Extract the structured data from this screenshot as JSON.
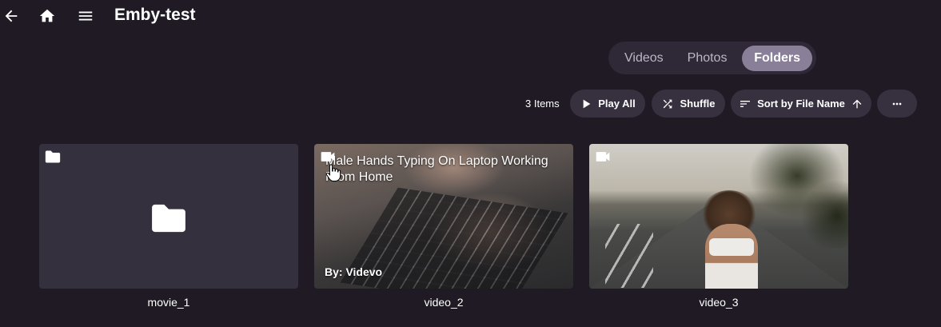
{
  "header": {
    "back_icon": "arrow-left-icon",
    "home_icon": "home-icon",
    "menu_icon": "hamburger-menu-icon",
    "title": "Emby-test"
  },
  "tabs": [
    {
      "label": "Videos",
      "active": false
    },
    {
      "label": "Photos",
      "active": false
    },
    {
      "label": "Folders",
      "active": true
    }
  ],
  "toolbar": {
    "items_count": "3 Items",
    "play_all": "Play All",
    "shuffle": "Shuffle",
    "sort": "Sort by File Name",
    "sort_direction": "ascending",
    "more_icon": "more-horizontal-icon"
  },
  "items": [
    {
      "name": "movie_1",
      "type": "folder",
      "icon": "folder-icon"
    },
    {
      "name": "video_2",
      "type": "video",
      "icon": "video-camera-icon",
      "overlay_title": "Male Hands Typing On Laptop Working From Home",
      "overlay_byline": "By: Videvo"
    },
    {
      "name": "video_3",
      "type": "video",
      "icon": "video-camera-icon"
    }
  ],
  "colors": {
    "background": "#1f1a24",
    "tab_bar": "#2e2837",
    "tab_active": "#8a7f98",
    "button_bg": "#36303f",
    "folder_card": "#35303d"
  }
}
